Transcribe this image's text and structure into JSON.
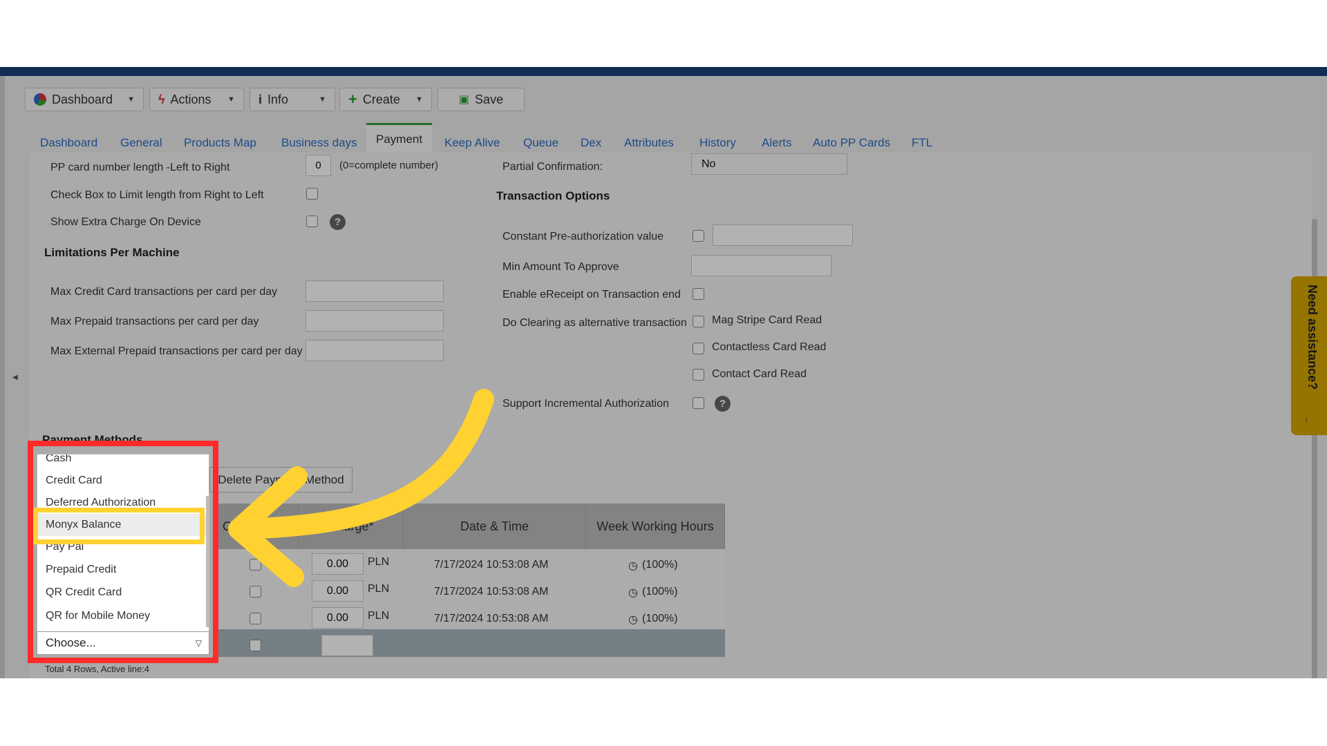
{
  "toolbar": {
    "dashboard": "Dashboard",
    "actions": "Actions",
    "info": "Info",
    "create": "Create",
    "save": "Save"
  },
  "tabs": [
    "Dashboard",
    "General",
    "Products Map",
    "Business days",
    "Payment",
    "Keep Alive",
    "Queue",
    "Dex",
    "Attributes",
    "History",
    "Alerts",
    "Auto PP Cards",
    "FTL"
  ],
  "left": {
    "pp_length_label": "PP card number length -Left to Right",
    "pp_length_value": "0",
    "pp_length_hint": "(0=complete number)",
    "limit_rtl_label": "Check Box to Limit length from Right to Left",
    "extra_charge_label": "Show Extra Charge On Device",
    "limitations_header": "Limitations Per Machine",
    "max_cc_label": "Max Credit Card transactions per card per day",
    "max_prepaid_label": "Max Prepaid transactions per card per day",
    "max_ext_prepaid_label": "Max External Prepaid transactions per card per day",
    "payment_methods_header": "Payment Methods",
    "delete_button": "Delete Payment Method",
    "total_rows": "Total 4 Rows, Active line:4"
  },
  "right": {
    "partial_conf_label": "Partial Confirmation:",
    "partial_conf_value": "No",
    "transaction_options_header": "Transaction Options",
    "const_preauth_label": "Constant Pre-authorization value",
    "min_amount_label": "Min Amount To Approve",
    "ereceipt_label": "Enable eReceipt on Transaction end",
    "clearing_label": "Do Clearing as alternative transaction",
    "mag_stripe": "Mag Stripe Card Read",
    "contactless": "Contactless Card Read",
    "contact": "Contact Card Read",
    "incremental_label": "Support Incremental Authorization"
  },
  "table": {
    "headers": {
      "confirmation": "Confirmation",
      "charge": "Charge*",
      "datetime": "Date & Time",
      "hours": "Week Working Hours"
    },
    "rows": [
      {
        "charge": "0.00",
        "currency": "PLN",
        "datetime": "7/17/2024 10:53:08 AM",
        "hours": "(100%)"
      },
      {
        "charge": "0.00",
        "currency": "PLN",
        "datetime": "7/17/2024 10:53:08 AM",
        "hours": "(100%)"
      },
      {
        "charge": "0.00",
        "currency": "PLN",
        "datetime": "7/17/2024 10:53:08 AM",
        "hours": "(100%)"
      }
    ]
  },
  "dropdown": {
    "options": [
      "Cash",
      "Credit Card",
      "Deferred Authorization",
      "Monyx Balance",
      "Pay Pal",
      "Prepaid Credit",
      "QR Credit Card",
      "QR for Mobile Money"
    ],
    "highlighted": "Monyx Balance",
    "selected": "Choose..."
  },
  "assist": {
    "label": "Need assistance?"
  },
  "colors": {
    "accent_arrow": "#ffd232",
    "highlight_box": "#ff2a2a",
    "topbar": "#1b3f78"
  }
}
